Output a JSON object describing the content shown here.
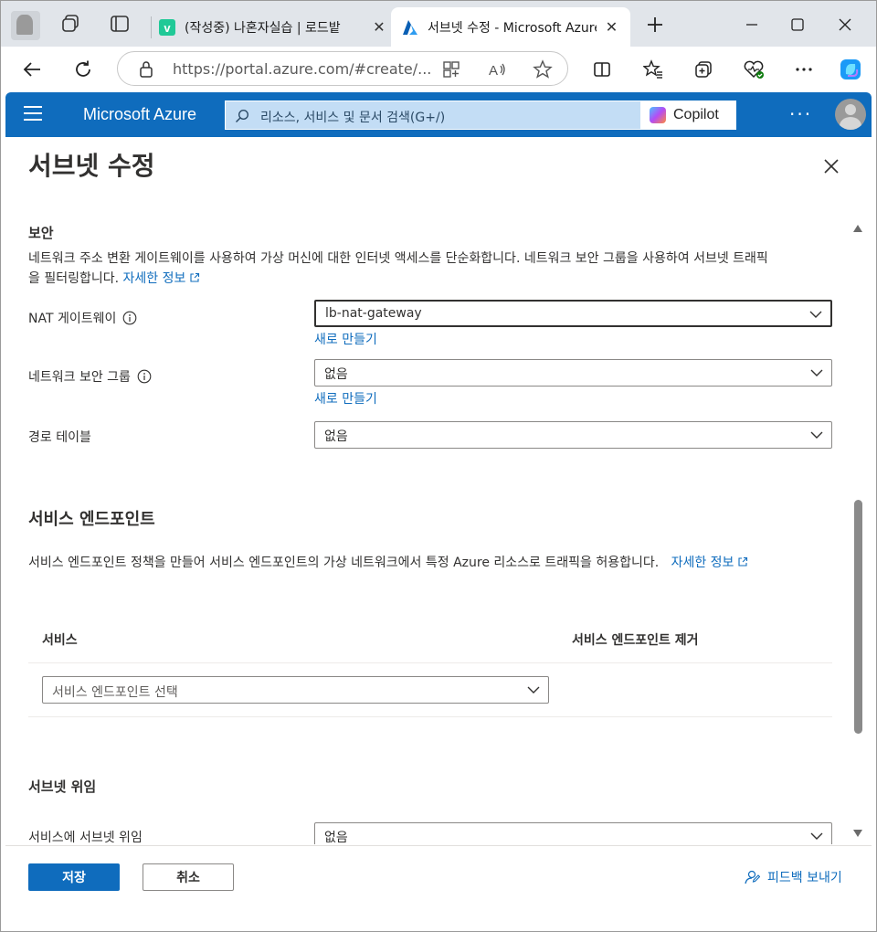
{
  "browser": {
    "tabs": [
      {
        "title": "(작성중) 나혼자실습 | 로드밭",
        "favicon": "velog-favicon",
        "active": false
      },
      {
        "title": "서브넷 수정 - Microsoft Azure",
        "favicon": "azure-favicon",
        "active": true
      }
    ],
    "address_url": "https://portal.azure.com/#create/...",
    "colors": {
      "tabstrip": "#e1e5ea",
      "velog": "#20c997"
    }
  },
  "azure_header": {
    "brand": "Microsoft Azure",
    "search_placeholder": "리소스, 서비스 및 문서 검색(G+/)",
    "copilot_label": "Copilot",
    "more_label": "···",
    "accent_color": "#0f6cbd"
  },
  "blade": {
    "title": "서브넷 수정",
    "security": {
      "heading": "보안",
      "description_line1": "네트워크 주소 변환 게이트웨이를 사용하여 가상 머신에 대한 인터넷 액세스를 단순화합니다. 네트워크 보안 그룹을 사용하여 서브넷 트래픽",
      "description_line2": "을 필터링합니다.",
      "learn_more": "자세한 정보",
      "nat_gateway": {
        "label": "NAT 게이트웨이",
        "value": "lb-nat-gateway",
        "create_new": "새로 만들기"
      },
      "nsg": {
        "label": "네트워크 보안 그룹",
        "value": "없음",
        "create_new": "새로 만들기"
      },
      "route_table": {
        "label": "경로 테이블",
        "value": "없음"
      }
    },
    "service_endpoints": {
      "heading": "서비스 엔드포인트",
      "description": "서비스 엔드포인트 정책을 만들어 서비스 엔드포인트의 가상 네트워크에서 특정 Azure 리소스로 트래픽을 허용합니다.",
      "learn_more": "자세한 정보",
      "columns": [
        "서비스",
        "서비스 엔드포인트 제거"
      ],
      "service_placeholder": "서비스 엔드포인트 선택"
    },
    "subnet_delegation": {
      "heading": "서브넷 위임",
      "label": "서비스에 서브넷 위임",
      "value": "없음"
    }
  },
  "footer": {
    "save_label": "저장",
    "cancel_label": "취소",
    "feedback_label": "피드백 보내기"
  }
}
